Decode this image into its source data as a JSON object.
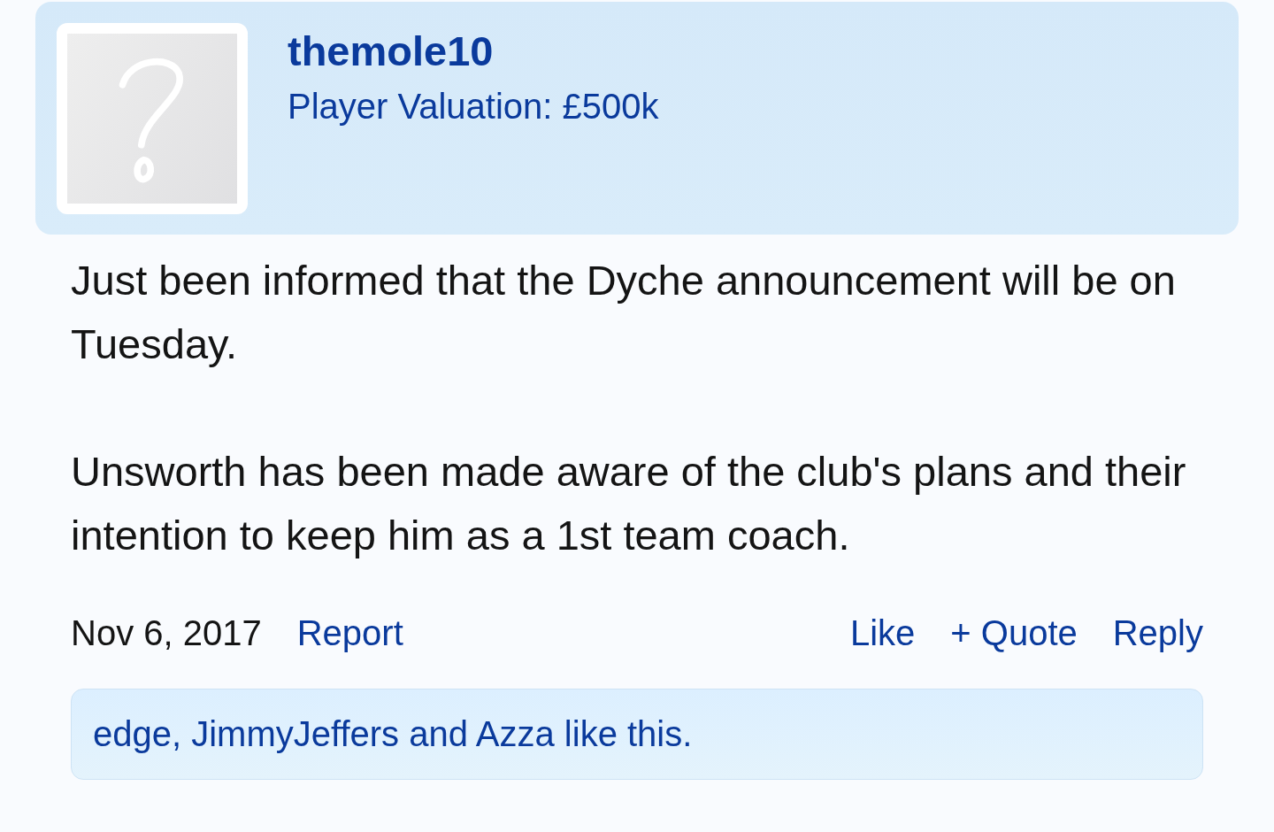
{
  "post": {
    "author": {
      "username": "themole10",
      "title": "Player Valuation: £500k"
    },
    "paragraphs": [
      "Just been informed that the Dyche announcement will be on Tuesday.",
      "Unsworth has been made aware of the club's plans and their intention to keep him as a 1st team coach."
    ],
    "date": "Nov 6, 2017",
    "actions_left": [
      "Report"
    ],
    "actions_right": [
      "Like",
      "+ Quote",
      "Reply"
    ],
    "likes_summary": "edge, JimmyJeffers and Azza like this."
  }
}
